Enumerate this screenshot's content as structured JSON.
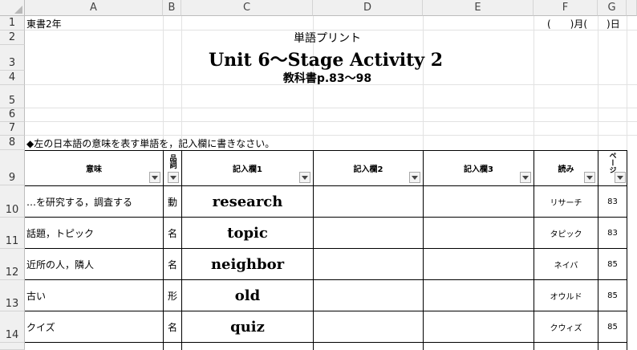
{
  "sheet": {
    "columns": [
      "A",
      "B",
      "C",
      "D",
      "E",
      "F",
      "G"
    ],
    "rows": [
      "1",
      "2",
      "3",
      "4",
      "5",
      "6",
      "7",
      "8",
      "9",
      "10",
      "11",
      "12",
      "13",
      "14"
    ],
    "class_label": "東書2年",
    "date_field": "(　　)月(　　)日",
    "doc_title": "単語プリント",
    "unit_title": "Unit 6～Stage Activity 2",
    "textbook_pages": "教科書p.83～98",
    "instruction": "◆左の日本語の意味を表す単語を，記入欄に書きなさい。",
    "headers": {
      "meaning": "意味",
      "pos": "品詞",
      "entry1": "記入欄1",
      "entry2": "記入欄2",
      "entry3": "記入欄3",
      "reading": "読み",
      "page": "ページ"
    },
    "vocab": [
      {
        "meaning": "…を研究する，調査する",
        "pos": "動",
        "word": "research",
        "reading": "リサーチ",
        "page": "83"
      },
      {
        "meaning": "話題，トピック",
        "pos": "名",
        "word": "topic",
        "reading": "タピック",
        "page": "83"
      },
      {
        "meaning": "近所の人，隣人",
        "pos": "名",
        "word": "neighbor",
        "reading": "ネイバ",
        "page": "85"
      },
      {
        "meaning": "古い",
        "pos": "形",
        "word": "old",
        "reading": "オウルド",
        "page": "85"
      },
      {
        "meaning": "クイズ",
        "pos": "名",
        "word": "quiz",
        "reading": "クウィズ",
        "page": "85"
      }
    ]
  }
}
